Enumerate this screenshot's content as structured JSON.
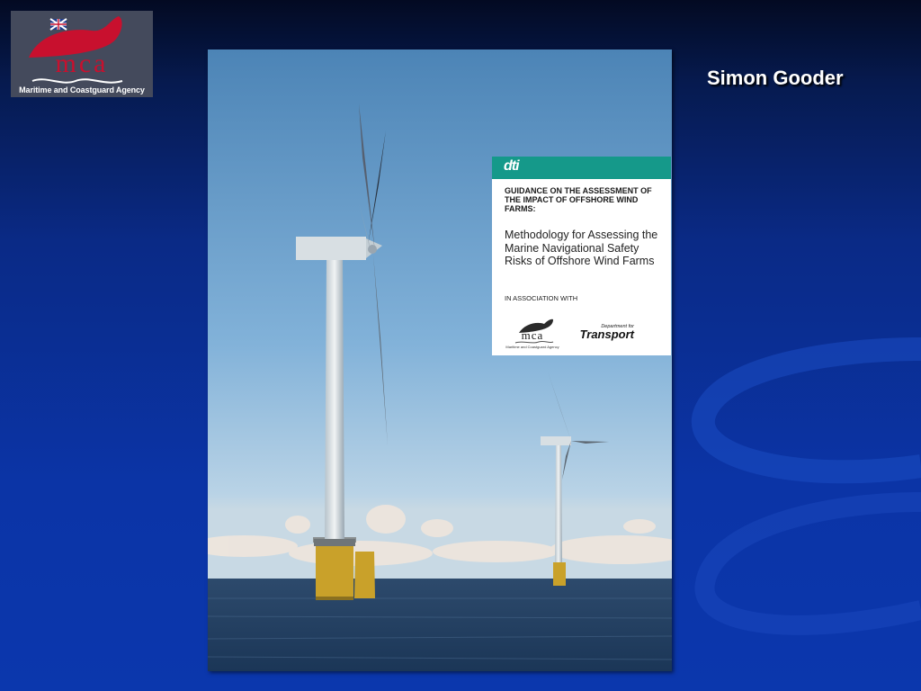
{
  "logo": {
    "wordmark": "mca",
    "caption": "Maritime and Coastguard Agency",
    "colors": {
      "background": "#444a5c",
      "red": "#c8102e",
      "white": "#ffffff"
    }
  },
  "presenter": "Simon Gooder",
  "cover": {
    "brand": "dti",
    "heading": "GUIDANCE ON THE ASSESSMENT OF THE IMPACT OF OFFSHORE WIND FARMS:",
    "subtitle": "Methodology for Assessing the Marine Navigational Safety Risks of Offshore Wind Farms",
    "association": "IN ASSOCIATION WITH",
    "partner_mca": {
      "wordmark": "mca",
      "caption": "Maritime and Coastguard Agency"
    },
    "partner_dft": {
      "line1": "Department for",
      "line2": "Transport"
    },
    "colors": {
      "teal": "#15998a"
    }
  }
}
